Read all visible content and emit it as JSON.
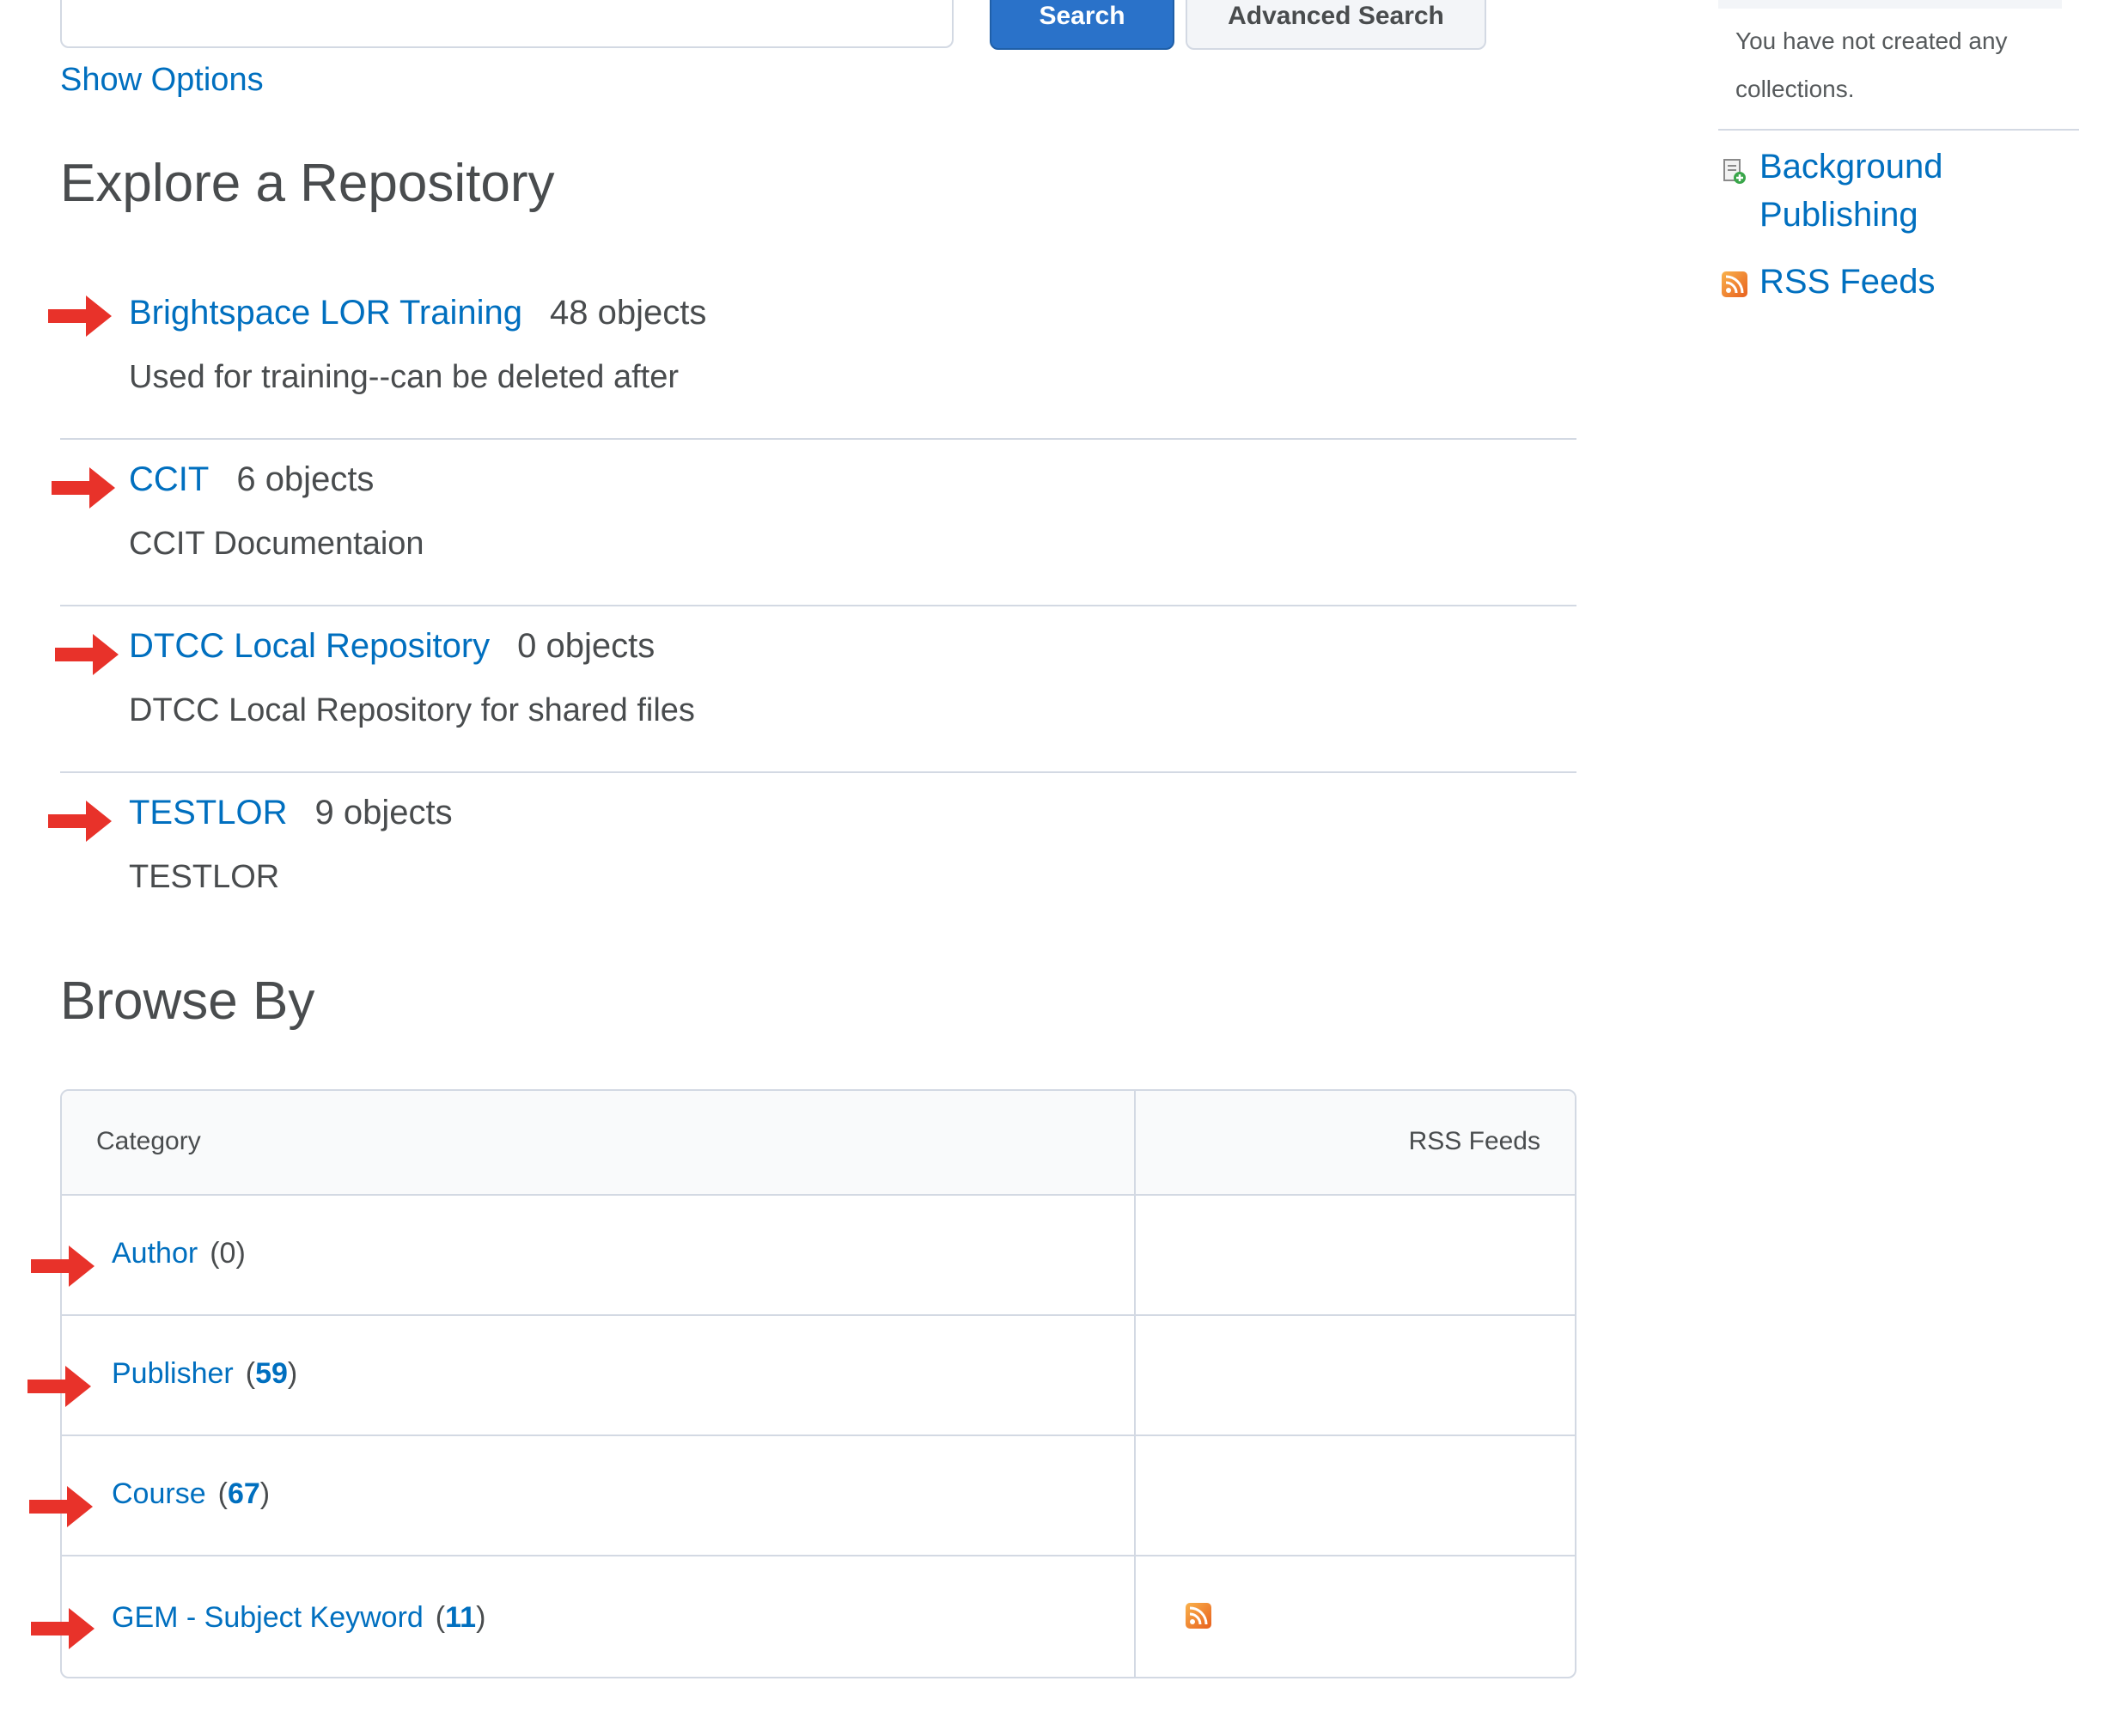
{
  "search": {
    "button_label": "Search",
    "advanced_label": "Advanced Search",
    "show_options": "Show Options"
  },
  "explore": {
    "heading": "Explore a Repository",
    "repos": [
      {
        "name": "Brightspace LOR Training",
        "count": "48 objects",
        "description": "Used for training--can be deleted after"
      },
      {
        "name": "CCIT",
        "count": "6 objects",
        "description": "CCIT Documentaion"
      },
      {
        "name": "DTCC Local Repository",
        "count": "0 objects",
        "description": "DTCC Local Repository for shared files"
      },
      {
        "name": "TESTLOR",
        "count": "9 objects",
        "description": "TESTLOR"
      }
    ]
  },
  "browse": {
    "heading": "Browse By",
    "columns": {
      "category": "Category",
      "rss": "RSS Feeds"
    },
    "rows": [
      {
        "label": "Author",
        "open": "(",
        "count": "0",
        "close": ")"
      },
      {
        "label": "Publisher",
        "open": "(",
        "count": "59",
        "close": ")"
      },
      {
        "label": "Course",
        "open": "(",
        "count": "67",
        "close": ")"
      },
      {
        "label": "GEM - Subject Keyword",
        "open": "(",
        "count": "11",
        "close": ")"
      }
    ]
  },
  "sidebar": {
    "collections_message": "You have not created any collections.",
    "background_publishing": "Background Publishing",
    "rss_feeds": "RSS Feeds"
  },
  "colors": {
    "link": "#006fbf",
    "primary_button": "#2a72c9",
    "annotation_arrow": "#e8322a"
  },
  "icons": {
    "publishing": "publishing-icon",
    "rss": "rss-icon",
    "arrow": "red-arrow-annotation"
  }
}
